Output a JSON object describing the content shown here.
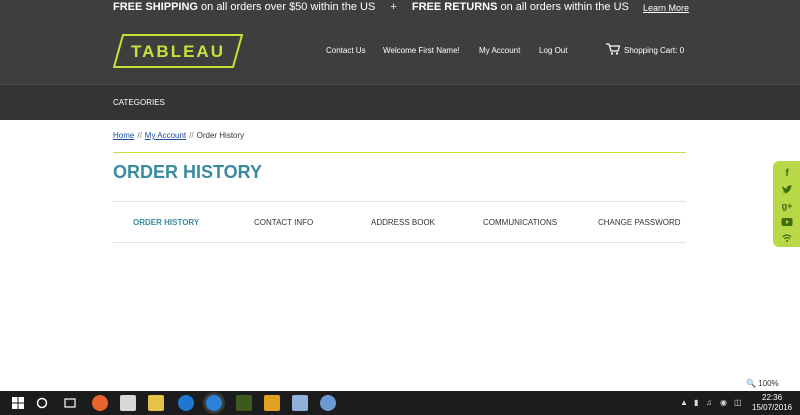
{
  "promo": {
    "shipping_bold": "FREE SHIPPING",
    "shipping_rest": " on all orders over $50 within the US",
    "plus": "+",
    "returns_bold": "FREE RETURNS",
    "returns_rest": " on all orders within the US",
    "learn_more": "Learn More"
  },
  "header": {
    "logo_text": "TABLEAU",
    "nav": {
      "contact": "Contact Us",
      "welcome": "Welcome First Name!",
      "account": "My Account",
      "logout": "Log Out",
      "cart": "Shopping Cart: 0"
    }
  },
  "categories_label": "CATEGORIES",
  "breadcrumb": {
    "home": "Home",
    "sep1": "//",
    "account": "My Account",
    "sep2": "//",
    "current": "Order History"
  },
  "page_title": "ORDER HISTORY",
  "tabs": [
    {
      "label": "ORDER HISTORY"
    },
    {
      "label": "CONTACT INFO"
    },
    {
      "label": "ADDRESS BOOK"
    },
    {
      "label": "COMMUNICATIONS"
    },
    {
      "label": "CHANGE PASSWORD"
    }
  ],
  "social_icons": [
    "facebook-icon",
    "twitter-icon",
    "google-plus-icon",
    "youtube-icon",
    "rss-icon"
  ],
  "status": {
    "zoom": "100%"
  },
  "taskbar": {
    "time": "22:36",
    "date": "15/07/2016"
  },
  "colors": {
    "accent": "#3a8ba0",
    "lime": "#c8e03a",
    "header_bg": "#3d3e3e"
  }
}
